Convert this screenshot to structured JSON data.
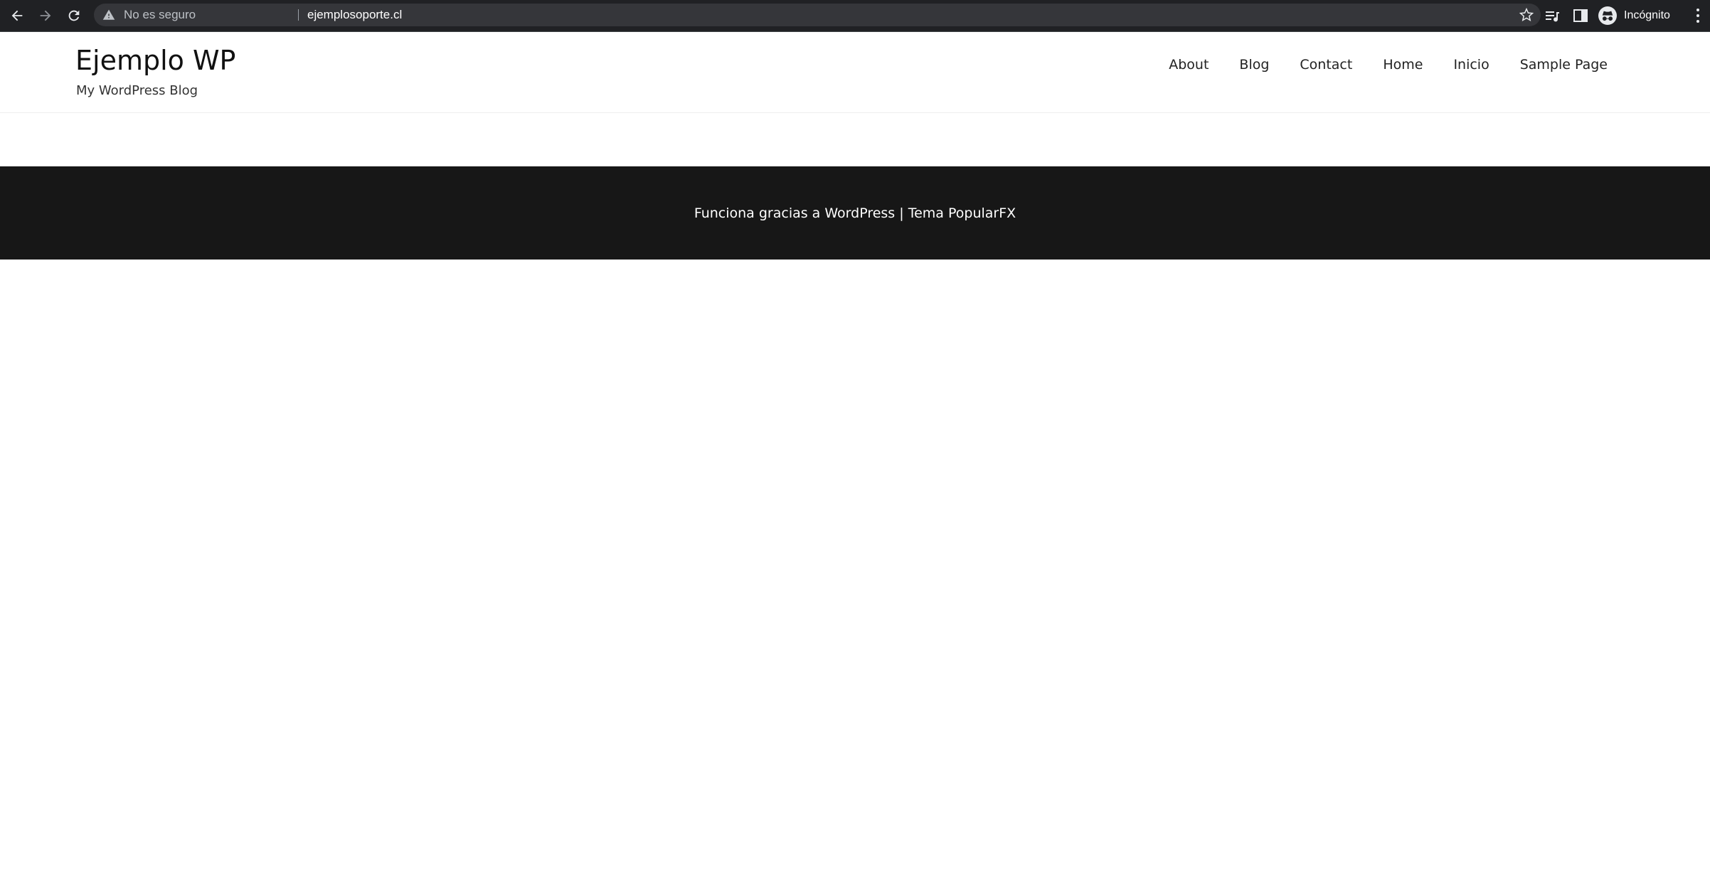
{
  "browser": {
    "security_label": "No es seguro",
    "url": "ejemplosoporte.cl",
    "profile_label": "Incógnito",
    "icons": [
      "back-icon",
      "forward-icon",
      "reload-icon",
      "warning-icon",
      "star-icon",
      "reading-list-icon",
      "side-panel-icon",
      "incognito-icon",
      "more-vert-icon"
    ],
    "colors": {
      "chrome_bg": "#202124",
      "omnibox_bg": "#35363a"
    }
  },
  "site": {
    "title": "Ejemplo WP",
    "tagline": "My WordPress Blog",
    "nav": [
      "About",
      "Blog",
      "Contact",
      "Home",
      "Inicio",
      "Sample Page"
    ]
  },
  "footer": {
    "powered": "Funciona gracias a WordPress",
    "divider": "|",
    "theme": "Tema PopularFX",
    "bg": "#171717"
  }
}
